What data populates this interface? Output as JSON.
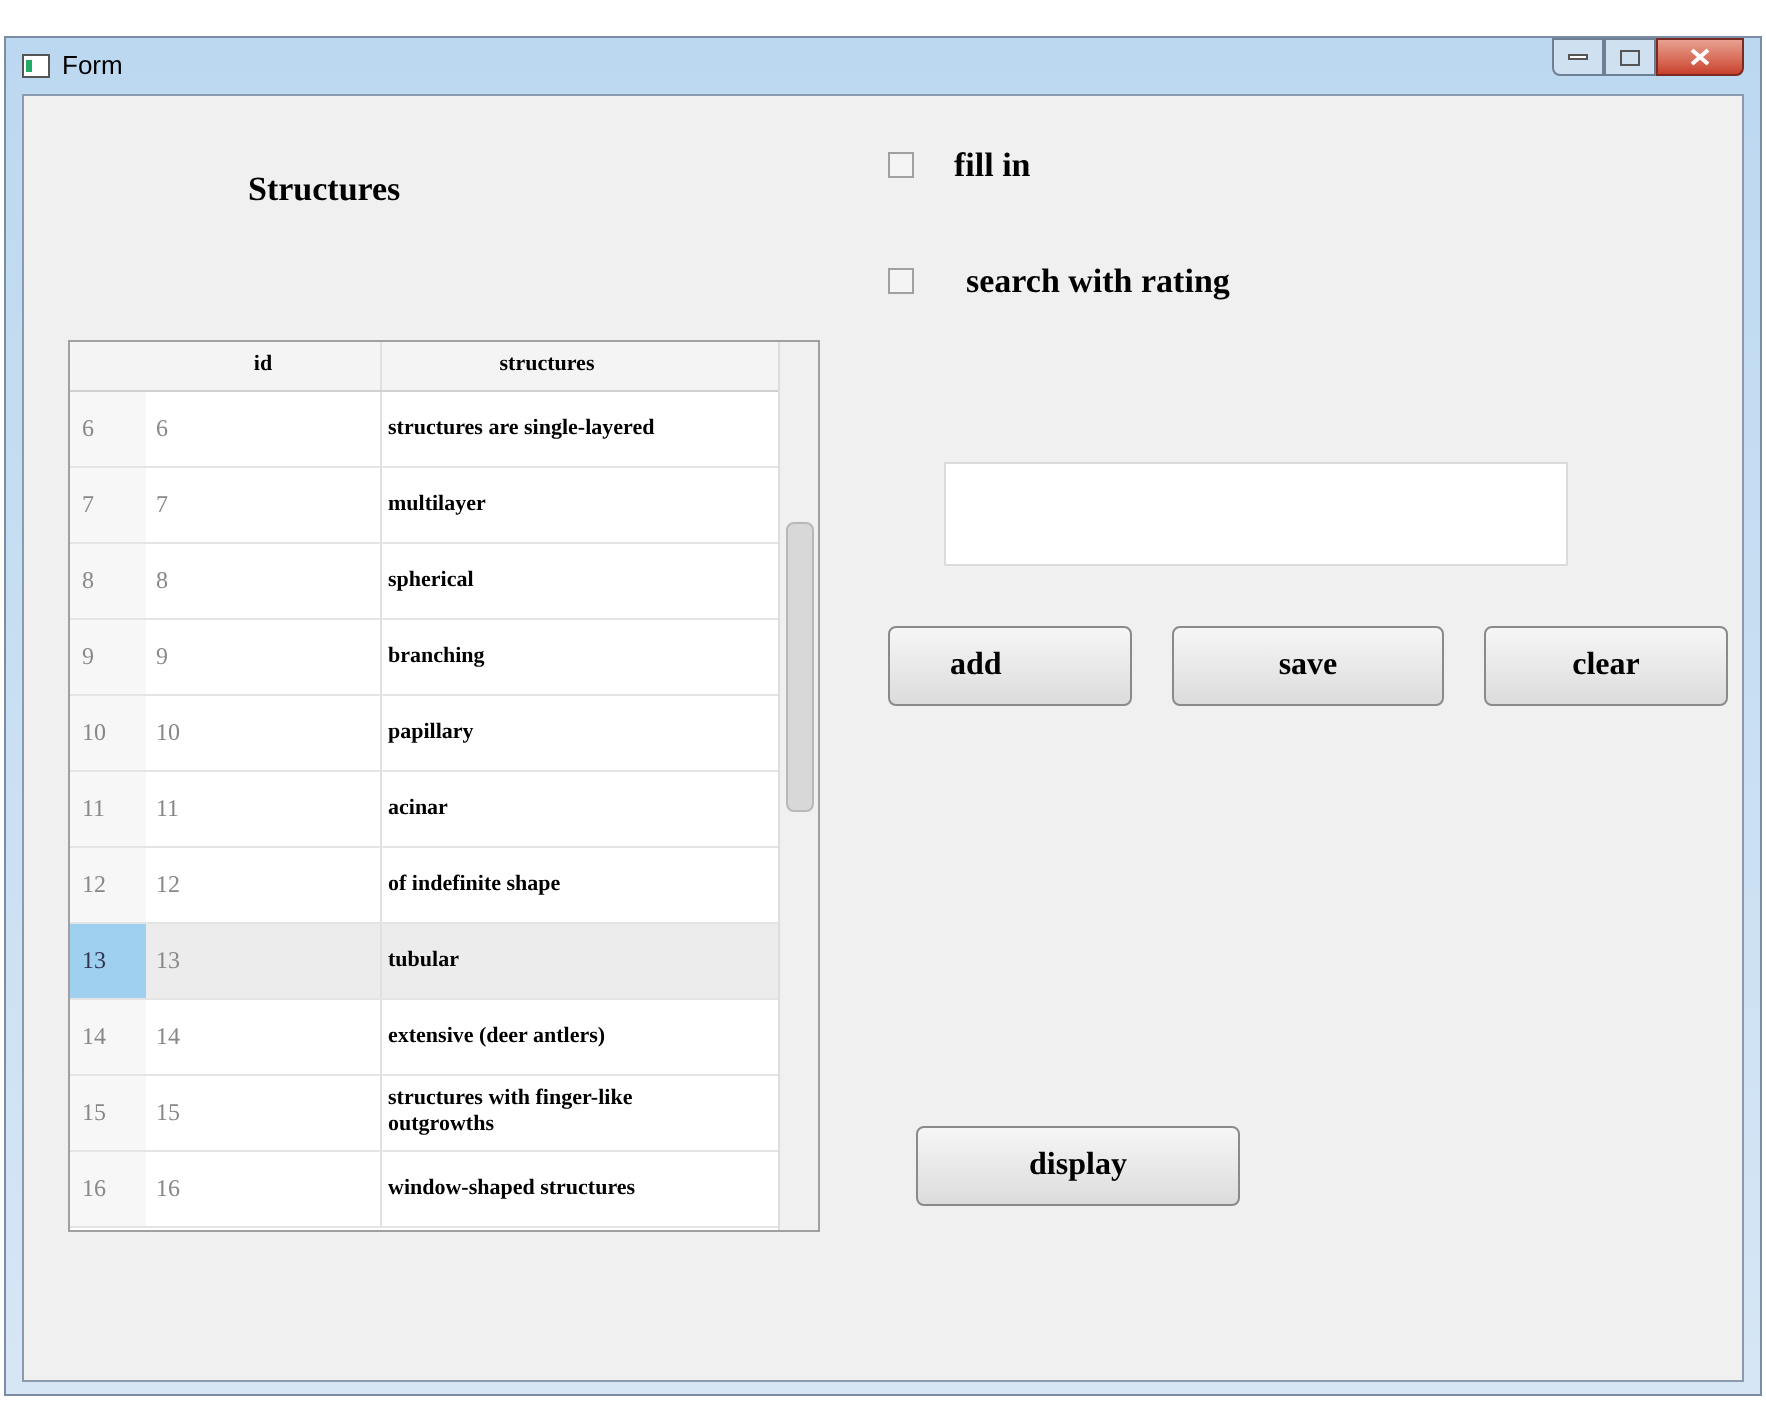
{
  "window": {
    "title": "Form"
  },
  "structures_label": "Structures",
  "checkboxes": [
    {
      "label": "fill in",
      "checked": false
    },
    {
      "label": "search with rating",
      "checked": false
    }
  ],
  "buttons": [
    "add",
    "save",
    "clear"
  ],
  "display_button": "display",
  "table": {
    "columns": [
      "id",
      "structures"
    ],
    "rows": [
      {
        "header": "6",
        "id": "6",
        "structures": "structures are single-layered",
        "selected": false
      },
      {
        "header": "7",
        "id": "7",
        "structures": "multilayer",
        "selected": false
      },
      {
        "header": "8",
        "id": "8",
        "structures": "spherical",
        "selected": false
      },
      {
        "header": "9",
        "id": "9",
        "structures": "branching",
        "selected": false
      },
      {
        "header": "10",
        "id": "10",
        "structures": "papillary",
        "selected": false
      },
      {
        "header": "11",
        "id": "11",
        "structures": "acinar",
        "selected": false
      },
      {
        "header": "12",
        "id": "12",
        "structures": "of indefinite shape",
        "selected": false
      },
      {
        "header": "13",
        "id": "13",
        "structures": "tubular",
        "selected": true
      },
      {
        "header": "14",
        "id": "14",
        "structures": "extensive (deer antlers)",
        "selected": false
      },
      {
        "header": "15",
        "id": "15",
        "structures": "structures with finger-like outgrowths",
        "selected": false
      },
      {
        "header": "16",
        "id": "16",
        "structures": "window-shaped structures",
        "selected": false
      }
    ]
  }
}
